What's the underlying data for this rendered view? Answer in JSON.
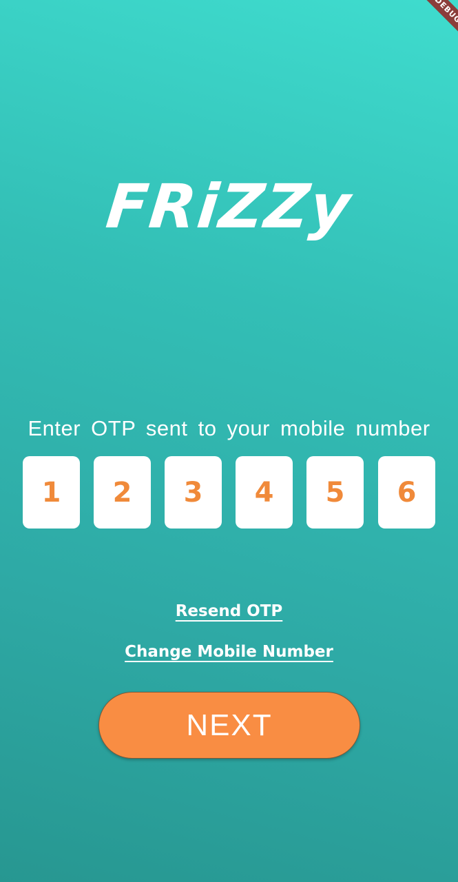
{
  "debug_banner": {
    "label": "DEBUG"
  },
  "app": {
    "logo_text": "FRiZZy"
  },
  "otp": {
    "prompt": "Enter OTP sent to your mobile number",
    "digits": [
      "1",
      "2",
      "3",
      "4",
      "5",
      "6"
    ]
  },
  "actions": {
    "resend_label": "Resend OTP",
    "change_number_label": "Change Mobile Number",
    "next_label": "NEXT"
  },
  "colors": {
    "gradient_top": "#3fdcce",
    "gradient_bottom": "#279791",
    "accent": "#f98d43",
    "digit_color": "#f08a3a"
  }
}
